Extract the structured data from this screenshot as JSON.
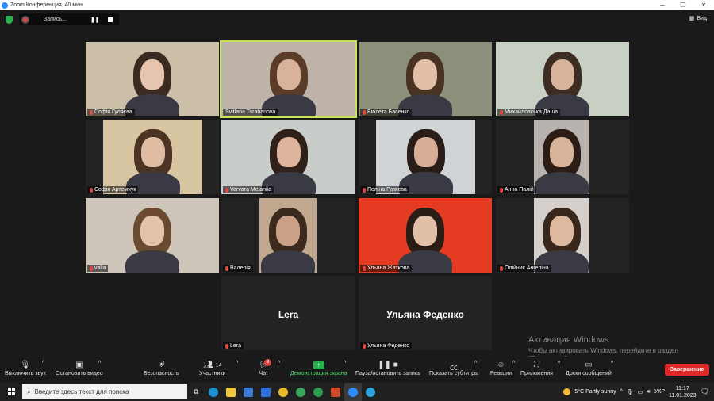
{
  "window": {
    "title": "Zoom Конференция, 40 мин"
  },
  "recording": {
    "label": "Запись..."
  },
  "view": {
    "label": "Вид"
  },
  "participants": [
    {
      "name": "Софія Гуляєва",
      "muted": true
    },
    {
      "name": "Svitlana Tarabanova",
      "muted": false
    },
    {
      "name": "Віолета Басенко",
      "muted": true
    },
    {
      "name": "Михайловська Даша",
      "muted": true
    },
    {
      "name": "Софія Артемчук",
      "muted": true
    },
    {
      "name": "Varvara Melaniia",
      "muted": true
    },
    {
      "name": "Поліна Гуляєва",
      "muted": true
    },
    {
      "name": "Анна Палій",
      "muted": true
    },
    {
      "name": "valia",
      "muted": true
    },
    {
      "name": "Валерія",
      "muted": true
    },
    {
      "name": "Ульяна Жаткова",
      "muted": true
    },
    {
      "name": "Олійник Ангеліна",
      "muted": true
    },
    {
      "name": "Lera",
      "muted": true,
      "no_video": true
    },
    {
      "name": "Ульяна Феденко",
      "muted": true,
      "no_video": true
    }
  ],
  "watermark": {
    "title": "Активация Windows",
    "text": "Чтобы активировать Windows, перейдите в раздел \"Параметры\"."
  },
  "toolbar": {
    "mute": "Выключить звук",
    "video": "Остановить видео",
    "security": "Безопасность",
    "participants": "Участники",
    "participants_count": "14",
    "chat": "Чат",
    "chat_badge": "9",
    "share": "Демонстрация экрана",
    "record": "Пауза/остановить запись",
    "captions": "Показать субтитры",
    "reactions": "Реакции",
    "apps": "Приложения",
    "whiteboards": "Доски сообщений",
    "end": "Завершение"
  },
  "taskbar": {
    "search_placeholder": "Введите здесь текст для поиска",
    "weather": "5°C  Partly sunny",
    "lang": "УКР",
    "time": "11:17",
    "date": "11.01.2023"
  },
  "colors": {
    "accent": "#2d8cff",
    "active_speaker": "#c7e35a",
    "end": "#e02828",
    "muted_icon": "#e5483f",
    "share": "#26b14c"
  }
}
